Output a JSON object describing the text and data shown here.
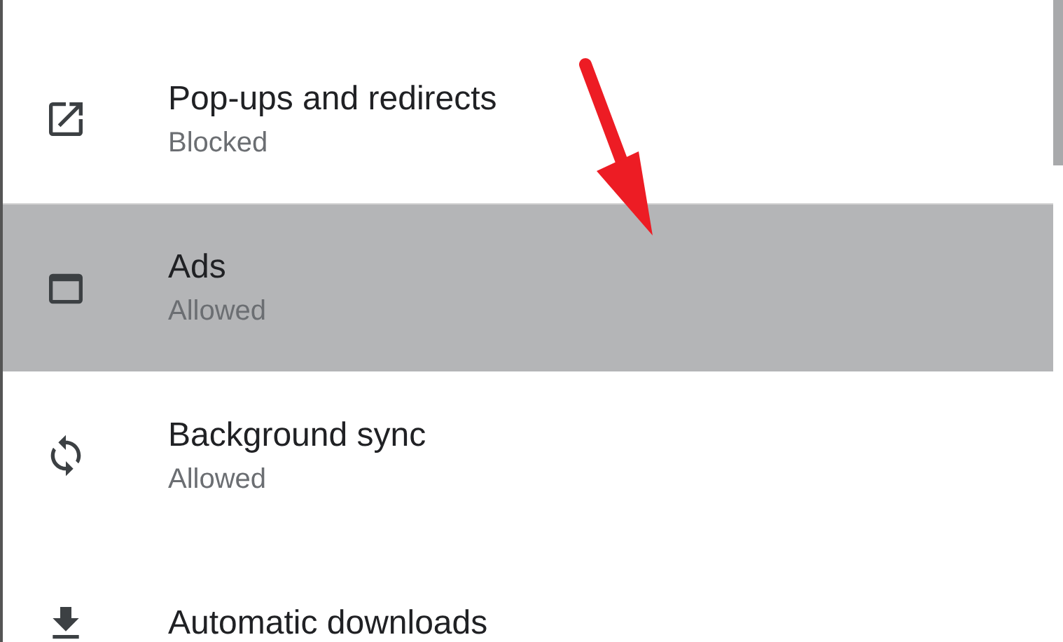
{
  "settings": [
    {
      "title": "Pop-ups and redirects",
      "status": "Blocked",
      "selected": false
    },
    {
      "title": "Ads",
      "status": "Allowed",
      "selected": true
    },
    {
      "title": "Background sync",
      "status": "Allowed",
      "selected": false
    },
    {
      "title": "Automatic downloads",
      "selected": false
    }
  ]
}
